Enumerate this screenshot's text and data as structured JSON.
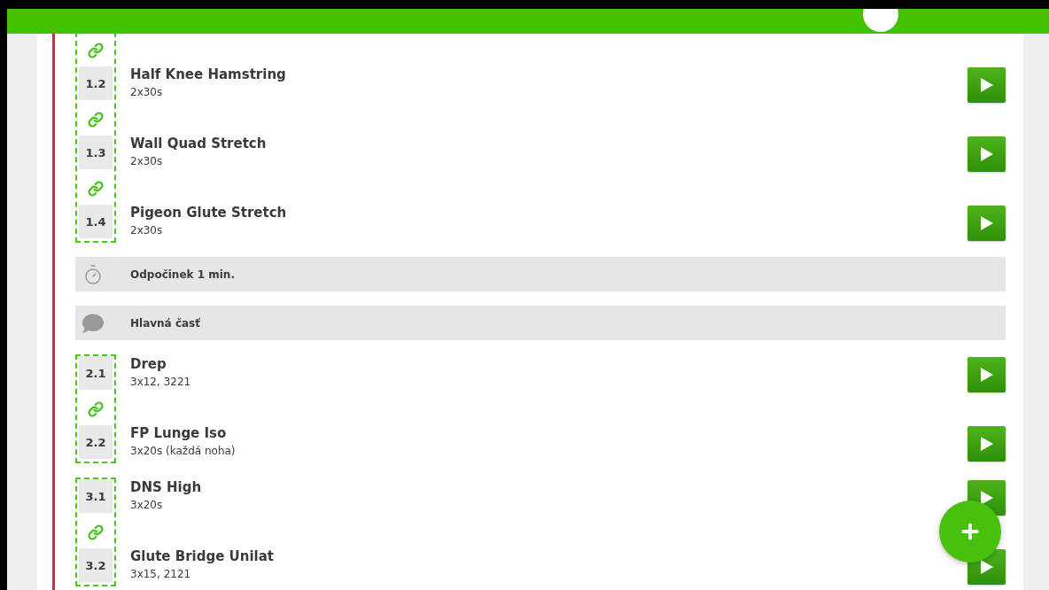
{
  "blocks": [
    {
      "kind": "group",
      "items": [
        {
          "number": "1.2",
          "name": "Half Knee Hamstring",
          "sets": "2x30s",
          "linked": true
        },
        {
          "number": "1.3",
          "name": "Wall Quad Stretch",
          "sets": "2x30s",
          "linked": true
        },
        {
          "number": "1.4",
          "name": "Pigeon Glute Stretch",
          "sets": "2x30s",
          "linked": true
        }
      ]
    },
    {
      "kind": "rest",
      "label": "Odpočinek 1 min."
    },
    {
      "kind": "note",
      "label": "Hlavná časť"
    },
    {
      "kind": "group",
      "items": [
        {
          "number": "2.1",
          "name": "Drep",
          "sets": "3x12, 3221",
          "linked": false
        },
        {
          "number": "2.2",
          "name": "FP Lunge Iso",
          "sets": "3x20s (každá noha)",
          "linked": true
        }
      ]
    },
    {
      "kind": "group",
      "items": [
        {
          "number": "3.1",
          "name": "DNS High",
          "sets": "3x20s",
          "linked": false
        },
        {
          "number": "3.2",
          "name": "Glute Bridge Unilat",
          "sets": "3x15, 2121",
          "linked": true
        }
      ]
    }
  ]
}
